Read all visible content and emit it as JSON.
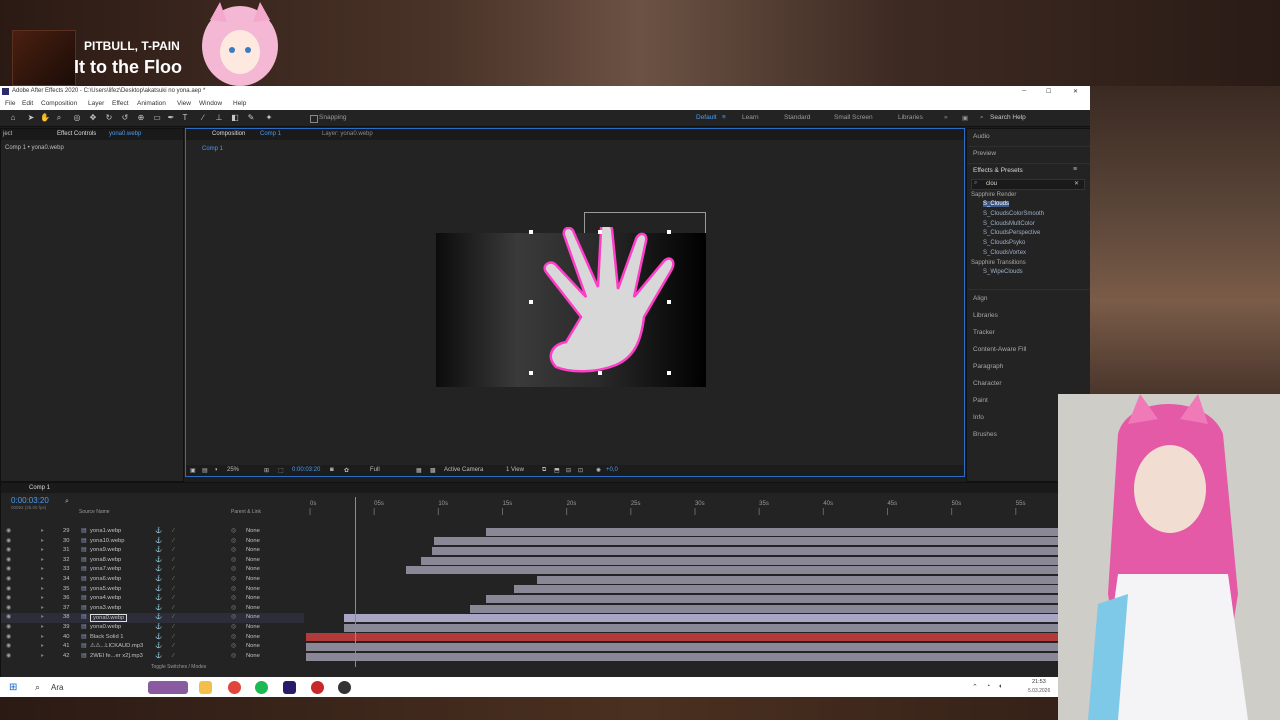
{
  "overlay": {
    "music_artist": "PITBULL, T-PAIN",
    "music_title": "It to the Floo"
  },
  "window": {
    "title": "Adobe After Effects 2020 - C:\\Users\\lifez\\Desktop\\akatsuki no yona.aep *",
    "controls": {
      "minimize": "─",
      "maximize": "☐",
      "close": "✕"
    }
  },
  "menu": [
    "File",
    "Edit",
    "Composition",
    "Layer",
    "Effect",
    "Animation",
    "View",
    "Window",
    "Help"
  ],
  "toolbar": {
    "snapping": "Snapping",
    "workspaces": [
      "Default",
      "Learn",
      "Standard",
      "Small Screen",
      "Libraries"
    ],
    "active_workspace": "Default",
    "search_help": "Search Help"
  },
  "left_panel": {
    "tab_project": "ject",
    "tab_effect_controls": "Effect Controls",
    "tab_effect_controls_layer": "yona0.webp",
    "breadcrumb": "Comp 1 • yona0.webp"
  },
  "comp_panel": {
    "tab_label": "Composition",
    "tab_comp": "Comp 1",
    "tab_layer": "Layer: yona0.webp",
    "sub_tab": "Comp 1",
    "zoom": "25%",
    "timecode": "0:00:03:20",
    "resolution": "Full",
    "camera": "Active Camera",
    "view": "1 View",
    "exposure": "+0,0"
  },
  "right_panel": {
    "sections": [
      "Audio",
      "Preview",
      "Effects & Presets",
      "Align",
      "Libraries",
      "Tracker",
      "Content-Aware Fill",
      "Paragraph",
      "Character",
      "Paint",
      "Info",
      "Brushes"
    ],
    "search_value": "clou",
    "categories": [
      {
        "name": "Sapphire Render",
        "items": [
          "S_Clouds",
          "S_CloudsColorSmooth",
          "S_CloudsMultColor",
          "S_CloudsPerspective",
          "S_CloudsPsyko",
          "S_CloudsVortex"
        ]
      },
      {
        "name": "Sapphire Transitions",
        "items": [
          "S_WipeClouds"
        ]
      }
    ],
    "selected_item": "S_Clouds"
  },
  "timeline": {
    "tab": "Comp 1",
    "timecode": "0:00:03:20",
    "fps_note": "00092 (25.00 fps)",
    "col_source": "Source Name",
    "col_parent": "Parent & Link",
    "ruler": [
      "0s",
      "05s",
      "10s",
      "15s",
      "20s",
      "25s",
      "30s",
      "35s",
      "40s",
      "45s",
      "50s",
      "55s"
    ],
    "playhead_seconds": 3.8,
    "duration_seconds": 58.6,
    "toggle_label": "Toggle Switches / Modes",
    "layers": [
      {
        "num": "29",
        "name": "yona1.webp",
        "parent": "None",
        "start": 14.0,
        "end": 58.6
      },
      {
        "num": "30",
        "name": "yona10.webp",
        "parent": "None",
        "start": 10.0,
        "end": 58.6
      },
      {
        "num": "31",
        "name": "yona9.webp",
        "parent": "None",
        "start": 9.8,
        "end": 58.6
      },
      {
        "num": "32",
        "name": "yona8.webp",
        "parent": "None",
        "start": 9.0,
        "end": 58.6
      },
      {
        "num": "33",
        "name": "yona7.webp",
        "parent": "None",
        "start": 7.8,
        "end": 58.6
      },
      {
        "num": "34",
        "name": "yona6.webp",
        "parent": "None",
        "start": 18.0,
        "end": 58.6
      },
      {
        "num": "35",
        "name": "yona5.webp",
        "parent": "None",
        "start": 16.2,
        "end": 58.6
      },
      {
        "num": "36",
        "name": "yona4.webp",
        "parent": "None",
        "start": 14.0,
        "end": 58.6
      },
      {
        "num": "37",
        "name": "yona3.webp",
        "parent": "None",
        "start": 12.8,
        "end": 58.6
      },
      {
        "num": "38",
        "name": "yona0.webp",
        "parent": "None",
        "start": 3.0,
        "end": 58.6,
        "selected": true
      },
      {
        "num": "39",
        "name": "yona0.webp",
        "parent": "None",
        "start": 3.0,
        "end": 58.6
      },
      {
        "num": "40",
        "name": "Black Solid 1",
        "parent": "None",
        "start": 0.0,
        "end": 58.6,
        "color": "#b23a3a"
      },
      {
        "num": "41",
        "name": "⚠⚠...LICKAUD.mp3",
        "parent": "None",
        "start": 0.0,
        "end": 58.6
      },
      {
        "num": "42",
        "name": "2WEI fe...er x2].mp3",
        "parent": "None",
        "start": 0.0,
        "end": 58.6
      }
    ]
  },
  "taskbar": {
    "search_text": "Ara",
    "clock_time": "21:53",
    "clock_date": "5.03.2026"
  },
  "colors": {
    "accent": "#4b9cf0",
    "mask": "#ff3ec8",
    "solid_layer": "#b23a3a",
    "layer_bar": "#8a8796"
  }
}
